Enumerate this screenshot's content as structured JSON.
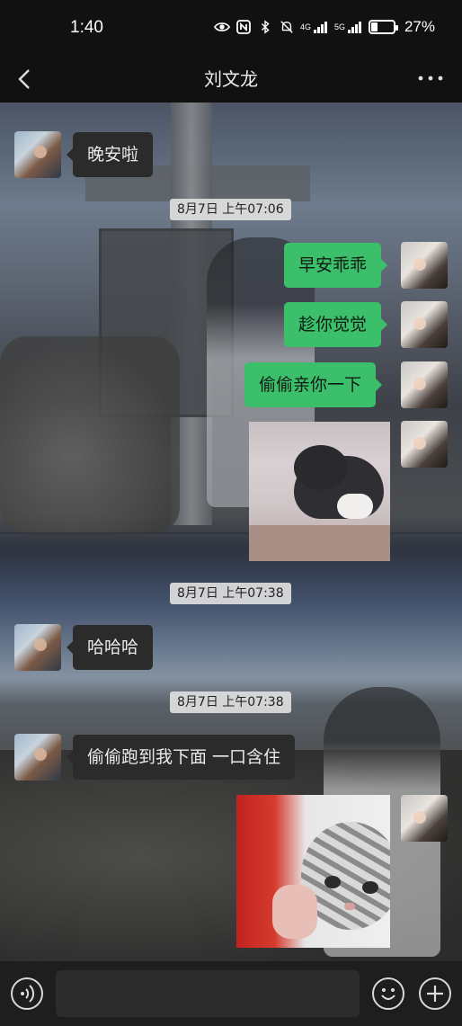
{
  "status_bar": {
    "time": "1:40",
    "signal1_label": "4G",
    "signal2_label": "5G",
    "battery_pct": "27%",
    "battery_level": 0.27
  },
  "header": {
    "title": "刘文龙"
  },
  "messages": [
    {
      "side": "left",
      "type": "text",
      "text": "晚安啦"
    },
    {
      "type": "timestamp",
      "text": "8月7日 上午07:06"
    },
    {
      "side": "right",
      "type": "text",
      "text": "早安乖乖"
    },
    {
      "side": "right",
      "type": "text",
      "text": "趁你觉觉"
    },
    {
      "side": "right",
      "type": "text",
      "text": "偷偷亲你一下"
    },
    {
      "side": "right",
      "type": "sticker",
      "sticker": "cat-sticker"
    },
    {
      "type": "timestamp",
      "text": "8月7日 上午07:38"
    },
    {
      "side": "left",
      "type": "text",
      "text": "哈哈哈"
    },
    {
      "type": "timestamp",
      "text": "8月7日 上午07:38"
    },
    {
      "side": "left",
      "type": "text",
      "text": "偷偷跑到我下面 一口含住"
    },
    {
      "side": "right",
      "type": "sticker",
      "sticker": "cat-sticker"
    }
  ],
  "input_bar": {
    "value": "",
    "placeholder": ""
  },
  "icons": {
    "back": "chevron-left-icon",
    "more": "more-dots-icon",
    "voice": "voice-icon",
    "emoji": "emoji-icon",
    "plus": "plus-icon"
  },
  "colors": {
    "outgoing_bubble": "#3cbf6b",
    "incoming_bubble": "#2b2b2b",
    "top_bar": "#111111"
  }
}
